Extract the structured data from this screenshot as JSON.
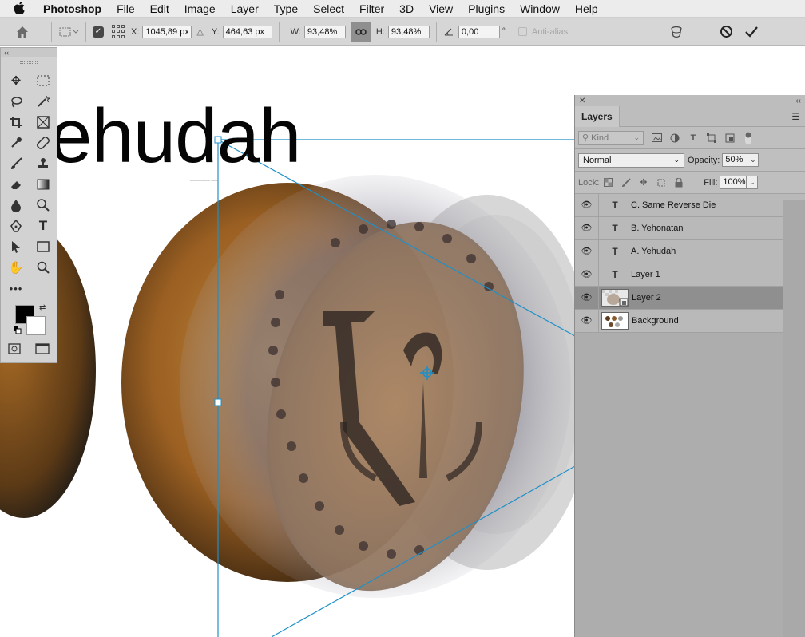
{
  "menubar": {
    "app_name": "Photoshop",
    "items": [
      "File",
      "Edit",
      "Image",
      "Layer",
      "Type",
      "Select",
      "Filter",
      "3D",
      "View",
      "Plugins",
      "Window",
      "Help"
    ]
  },
  "options": {
    "x_label": "X:",
    "x_value": "1045,89 px",
    "y_label": "Y:",
    "y_value": "464,63 px",
    "w_label": "W:",
    "w_value": "93,48%",
    "h_label": "H:",
    "h_value": "93,48%",
    "angle_value": "0,00",
    "degree": "°",
    "antialias_label": "Anti-alias"
  },
  "canvas": {
    "headline": "ehudah"
  },
  "layers_panel": {
    "tab_label": "Layers",
    "kind_label": "Kind",
    "blend_mode": "Normal",
    "opacity_label": "Opacity:",
    "opacity_value": "50%",
    "lock_label": "Lock:",
    "fill_label": "Fill:",
    "fill_value": "100%",
    "layers": [
      {
        "name": "C. Same Reverse Die",
        "type": "text"
      },
      {
        "name": "B. Yehonatan",
        "type": "text"
      },
      {
        "name": "A. Yehudah",
        "type": "text"
      },
      {
        "name": "Layer 1",
        "type": "text"
      },
      {
        "name": "Layer 2",
        "type": "smart-object",
        "selected": true
      },
      {
        "name": "Background",
        "type": "image",
        "locked": true
      }
    ]
  },
  "colors": {
    "transform_line": "#1e90c8",
    "foreground": "#000000",
    "background": "#ffffff",
    "panel": "#adadad",
    "selected_layer": "#8f8f8f"
  }
}
